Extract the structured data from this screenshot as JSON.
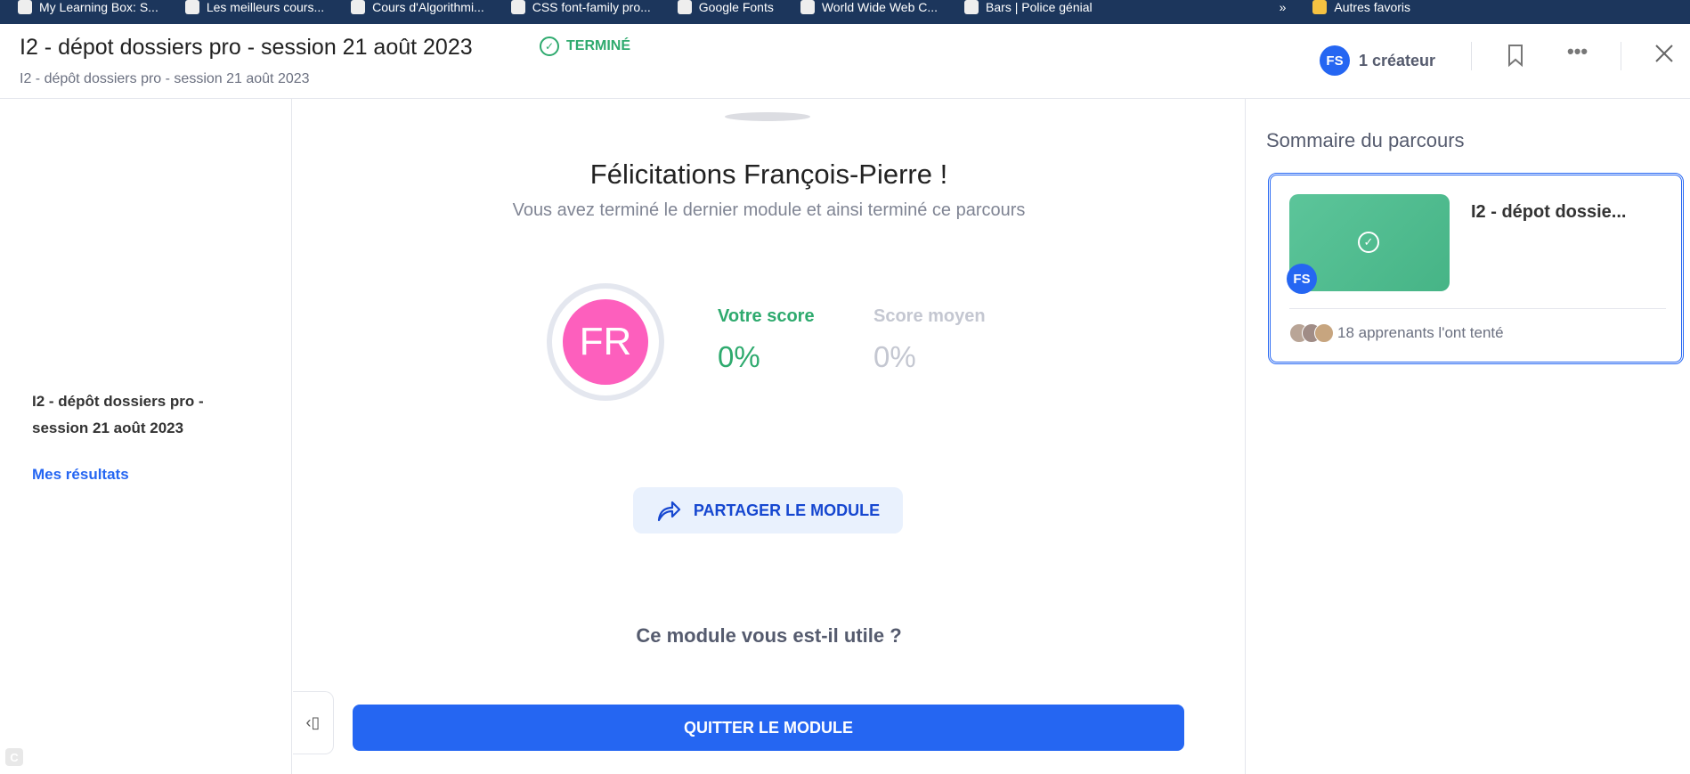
{
  "bookmarks": [
    "My Learning Box: S...",
    "Les meilleurs cours...",
    "Cours d'Algorithmi...",
    "CSS font-family pro...",
    "Google Fonts",
    "World Wide Web C...",
    "Bars | Police génial"
  ],
  "bookmarks_more": "»",
  "bookmarks_other": "Autres favoris",
  "header": {
    "title": "I2 - dépot dossiers pro - session 21 août 2023",
    "status": "TERMINÉ",
    "subtitle": "I2 - dépôt dossiers pro - session 21 août 2023",
    "creator_initials": "FS",
    "creator_label": "1 créateur"
  },
  "sidebar": {
    "title": "I2 - dépôt dossiers pro - session 21 août 2023",
    "results_link": "Mes résultats"
  },
  "main": {
    "heading": "Félicitations François-Pierre !",
    "subheading": "Vous avez terminé le dernier module et ainsi terminé ce parcours",
    "avatar_initials": "FR",
    "your_score_label": "Votre score",
    "your_score": "0%",
    "avg_score_label": "Score moyen",
    "avg_score": "0%",
    "share_label": "PARTAGER LE MODULE",
    "useful_question": "Ce module vous est-il utile ?",
    "quit_label": "QUITTER LE MODULE"
  },
  "summary": {
    "title": "Sommaire du parcours",
    "card_title": "I2 - dépot dossie...",
    "card_initials": "FS",
    "learners": "18 apprenants l'ont tenté"
  },
  "colors": {
    "accent": "#2566f2",
    "success": "#2eaa6e",
    "avatar": "#fd5fbd",
    "bookmark_bar": "#1c365c"
  }
}
